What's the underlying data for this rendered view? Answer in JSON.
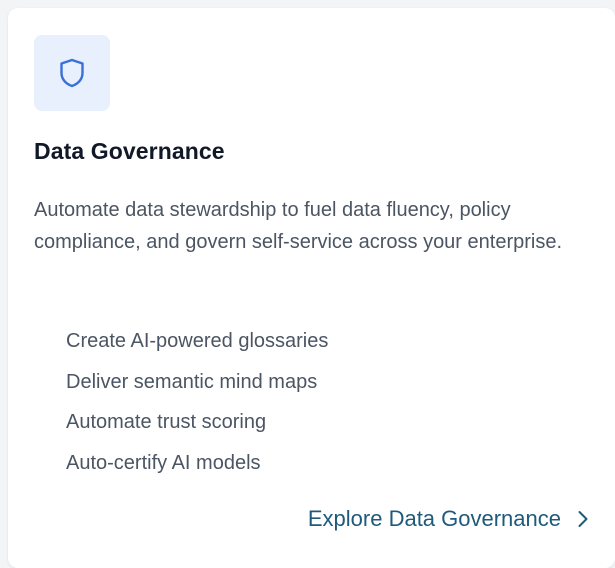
{
  "card": {
    "icon": "shield-icon",
    "title": "Data Governance",
    "description": "Automate data stewardship to fuel data fluency, policy compliance, and govern self-service across your enterprise.",
    "features": [
      "Create AI-powered glossaries",
      "Deliver semantic mind maps",
      "Automate trust scoring",
      "Auto-certify AI models"
    ],
    "cta_label": "Explore Data Governance",
    "cta_icon": "chevron-right-icon"
  },
  "colors": {
    "accent": "#3b6fd9",
    "icon_background": "#e8effd",
    "link": "#1f5a7a",
    "title": "#111827",
    "body": "#4b5563"
  }
}
